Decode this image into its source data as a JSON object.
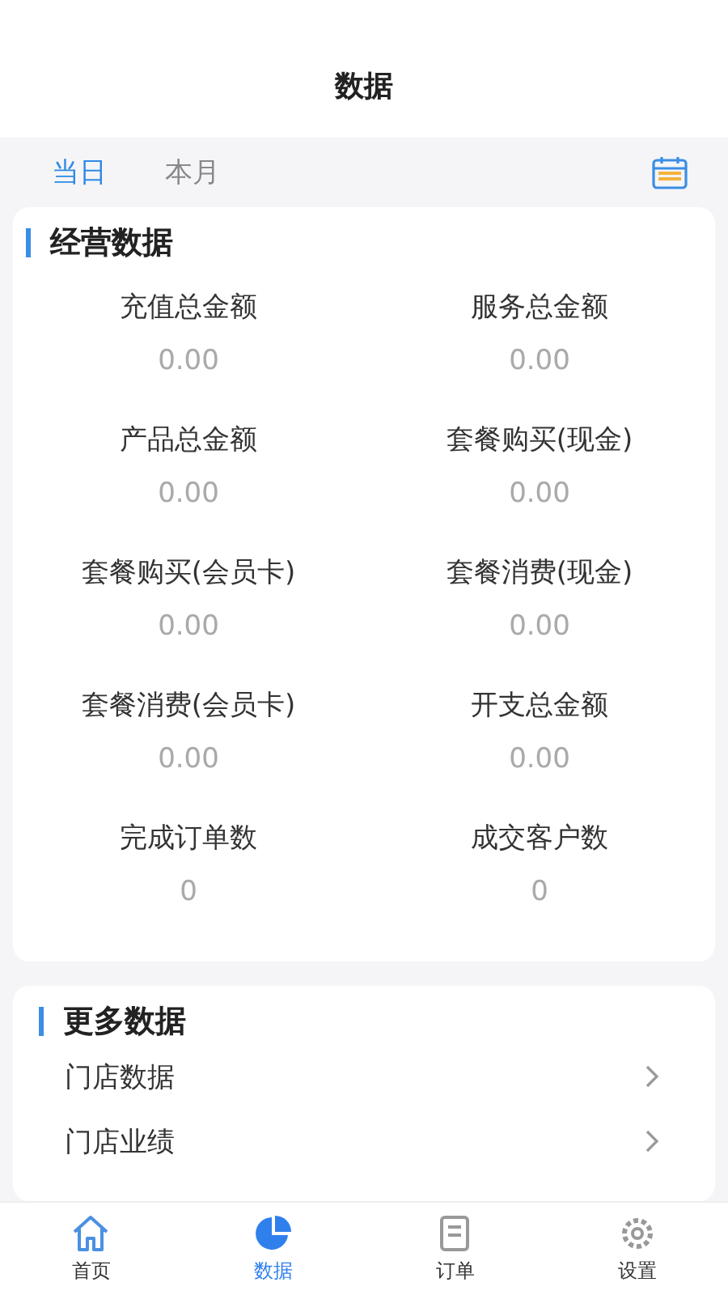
{
  "header": {
    "title": "数据"
  },
  "periods": [
    {
      "label": "当日",
      "selected": true
    },
    {
      "label": "本月",
      "selected": false
    }
  ],
  "business": {
    "title": "经营数据",
    "stats": [
      {
        "label": "充值总金额",
        "value": "0.00"
      },
      {
        "label": "服务总金额",
        "value": "0.00"
      },
      {
        "label": "产品总金额",
        "value": "0.00"
      },
      {
        "label": "套餐购买(现金)",
        "value": "0.00"
      },
      {
        "label": "套餐购买(会员卡)",
        "value": "0.00"
      },
      {
        "label": "套餐消费(现金)",
        "value": "0.00"
      },
      {
        "label": "套餐消费(会员卡)",
        "value": "0.00"
      },
      {
        "label": "开支总金额",
        "value": "0.00"
      },
      {
        "label": "完成订单数",
        "value": "0"
      },
      {
        "label": "成交客户数",
        "value": "0"
      }
    ]
  },
  "more": {
    "title": "更多数据",
    "items": [
      "门店数据",
      "门店业绩"
    ]
  },
  "tabbar": [
    {
      "label": "首页",
      "kind": "home",
      "selected": false
    },
    {
      "label": "数据",
      "kind": "chart",
      "selected": true
    },
    {
      "label": "订单",
      "kind": "order",
      "selected": false
    },
    {
      "label": "设置",
      "kind": "settings",
      "selected": false
    }
  ]
}
